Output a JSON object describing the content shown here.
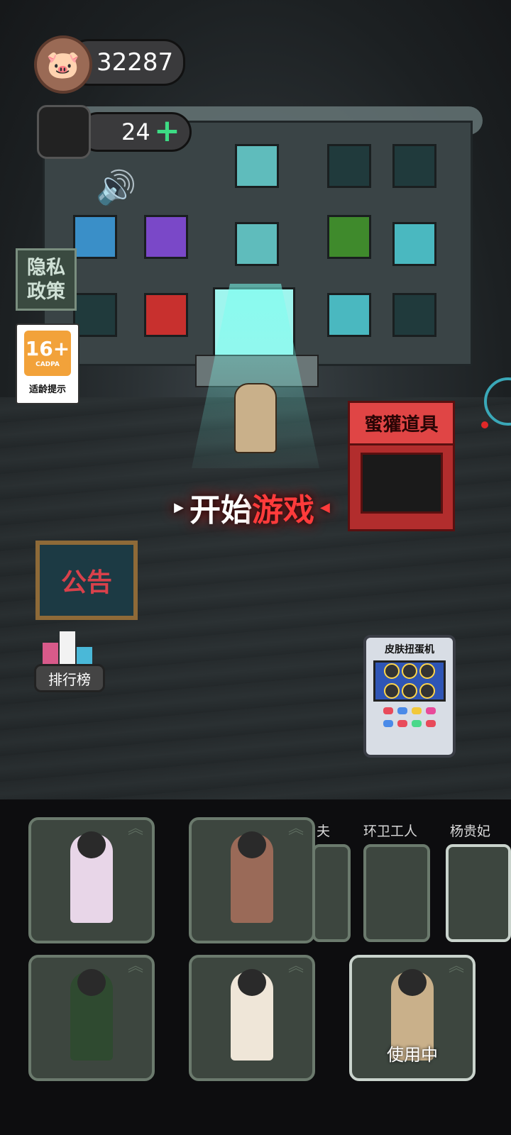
{
  "hud": {
    "coins": "32287",
    "pieces": "24",
    "plus_icon": "plus-icon",
    "coin_icon": "pig-coin-icon",
    "sound_icon": "speaker-icon"
  },
  "side": {
    "privacy": "隐私\n政策",
    "age_rating": "16+",
    "age_org": "CADPA",
    "age_caption": "适龄提示"
  },
  "main": {
    "start_white": "开始",
    "start_red": "游戏",
    "shop_sign": "蜜獾道具",
    "notice": "公告",
    "leaderboard": "排行榜",
    "gacha_title": "皮肤扭蛋机"
  },
  "dock": {
    "partial_labels": [
      "夫",
      "环卫工人",
      "杨贵妃"
    ],
    "in_use_label": "使用中"
  },
  "colors": {
    "accent_green": "#3ddc84",
    "start_red": "#ff3b3b",
    "shop_red": "#b22d2d",
    "card_bg": "#3d463f"
  }
}
